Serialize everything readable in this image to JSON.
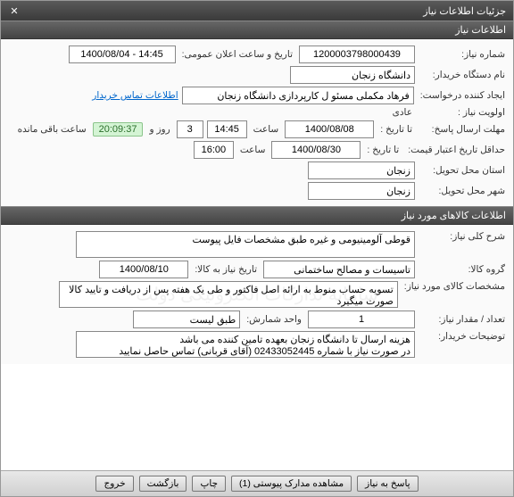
{
  "window": {
    "title": "جزئیات اطلاعات نیاز",
    "close": "✕"
  },
  "section1": {
    "title": "اطلاعات نیاز"
  },
  "fields": {
    "need_no_label": "شماره نیاز:",
    "need_no": "1200003798000439",
    "announce_label": "تاریخ و ساعت اعلان عمومی:",
    "announce_value": "1400/08/04 - 14:45",
    "buyer_label": "نام دستگاه خریدار:",
    "buyer_value": "دانشگاه زنجان",
    "requester_label": "ایجاد کننده درخواست:",
    "requester_value": "فرهاد مکملی مسئو ل کارپردازی دانشگاه زنجان",
    "buyer_contact_link": "اطلاعات تماس خریدار",
    "priority_label": "اولویت نیاز :",
    "priority_value": "عادی",
    "deadline_from_label": "مهلت ارسال پاسخ:",
    "to_date_label": "تا تاریخ :",
    "deadline_date": "1400/08/08",
    "time_label": "ساعت",
    "deadline_time": "14:45",
    "days_value": "3",
    "days_label": "روز و",
    "countdown": "20:09:37",
    "remaining_label": "ساعت باقی مانده",
    "validity_label": "حداقل تاریخ اعتبار قیمت:",
    "validity_date": "1400/08/30",
    "validity_time": "16:00",
    "province_label": "استان محل تحویل:",
    "province_value": "زنجان",
    "city_label": "شهر محل تحویل:",
    "city_value": "زنجان"
  },
  "section2": {
    "title": "اطلاعات کالاهای مورد نیاز"
  },
  "goods": {
    "desc_label": "شرح کلی نیاز:",
    "desc_value": "قوطی آلومینیومی و غیره طبق مشخصات فایل پیوست",
    "group_label": "گروه کالا:",
    "group_value": "تاسیسات و مصالح ساختمانی",
    "need_date_label": "تاریخ نیاز به کالا:",
    "need_date_value": "1400/08/10",
    "spec_label": "مشخصات کالای مورد نیاز:",
    "spec_value": "تسویه حساب منوط به ارائه اصل فاکتور و طی یک هفته پس از دریافت و تایید کالا صورت میگیرد",
    "qty_label": "تعداد / مقدار نیاز:",
    "qty_value": "1",
    "unit_label": "واحد شمارش:",
    "unit_value": "طبق لیست",
    "notes_label": "توضیحات خریدار:",
    "notes_value": "هزینه ارسال تا دانشگاه زنجان بعهده تامین کننده می باشد\nدر صورت نیاز با شماره 02433052445 (آقای قربانی) تماس حاصل نمایید"
  },
  "footer": {
    "respond": "پاسخ به نیاز",
    "attachments": "مشاهده مدارک پیوستی (1)",
    "print": "چاپ",
    "back": "بازگشت",
    "exit": "خروج"
  }
}
